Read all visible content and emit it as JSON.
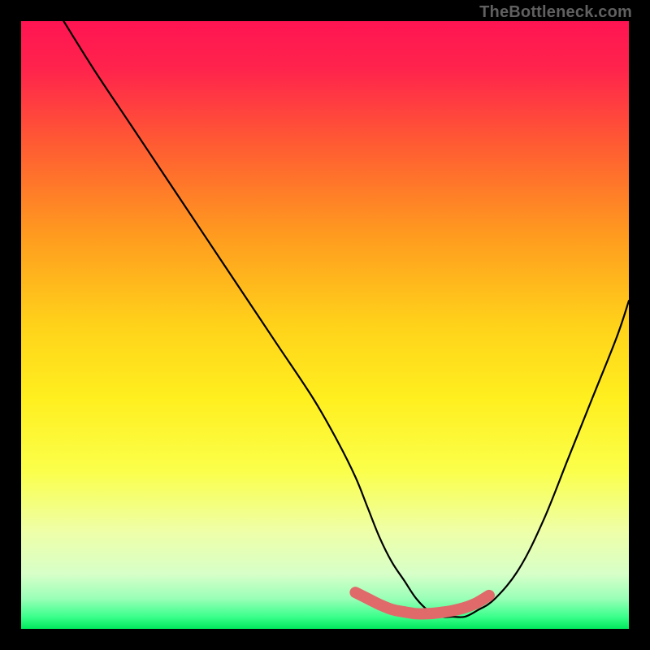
{
  "attribution": "TheBottleneck.com",
  "colors": {
    "bg_black": "#000000",
    "grad_top": "#ff1a4a",
    "grad_upper_mid": "#ff7a1f",
    "grad_mid": "#ffe600",
    "grad_lower_mid": "#f3ff66",
    "grad_green": "#00e85c",
    "curve": "#000000",
    "marker": "#e06a6a"
  },
  "chart_data": {
    "type": "line",
    "title": "",
    "xlabel": "",
    "ylabel": "",
    "xlim": [
      0,
      100
    ],
    "ylim": [
      0,
      100
    ],
    "series": [
      {
        "name": "curve",
        "x": [
          7,
          12,
          18,
          24,
          30,
          36,
          42,
          48,
          52,
          55,
          57,
          59,
          61,
          63,
          65,
          67,
          69,
          71,
          73,
          75,
          78,
          82,
          86,
          90,
          94,
          98,
          100
        ],
        "y": [
          100,
          92,
          83,
          74,
          65,
          56,
          47,
          38,
          31,
          25,
          20,
          15,
          11,
          8,
          5,
          3,
          2,
          2,
          2,
          3,
          5,
          10,
          18,
          28,
          38,
          48,
          54
        ]
      },
      {
        "name": "highlight",
        "x": [
          55,
          57,
          59,
          61,
          63,
          65,
          67,
          69,
          71,
          73,
          75,
          77
        ],
        "y": [
          6,
          5,
          4,
          3.2,
          2.8,
          2.5,
          2.5,
          2.7,
          3.0,
          3.5,
          4.3,
          5.5
        ]
      }
    ]
  }
}
